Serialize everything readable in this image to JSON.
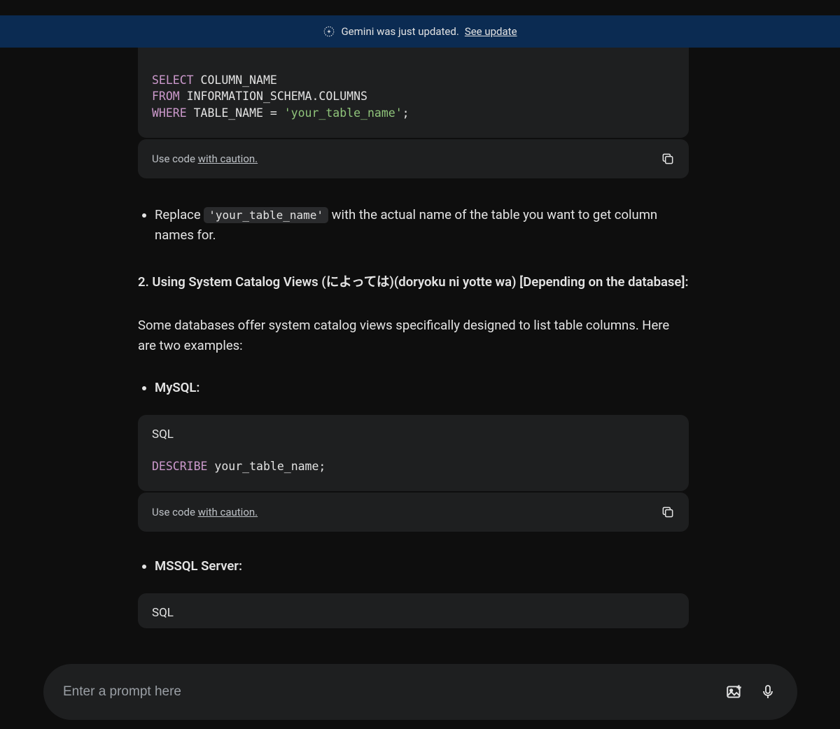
{
  "banner": {
    "text": "Gemini was just updated.",
    "link": "See update"
  },
  "code1": {
    "select": "SELECT",
    "col_name": " COLUMN_NAME",
    "from": "FROM",
    "info_schema": " INFORMATION_SCHEMA.COLUMNS",
    "where": "WHERE",
    "table_eq": " TABLE_NAME = ",
    "str": "'your_table_name'",
    "semi": ";"
  },
  "caution": {
    "prefix": "Use code ",
    "link": "with caution."
  },
  "replace_line": {
    "pre": "Replace ",
    "code": "'your_table_name'",
    "post": " with the actual name of the table you want to get column names for."
  },
  "heading2": "2. Using System Catalog Views (によっては)(doryoku ni yotte wa) [Depending on the database]:",
  "para2": "Some databases offer system catalog views specifically designed to list table columns. Here are two examples:",
  "mysql_label": "MySQL:",
  "sql_label": "SQL",
  "code2": {
    "describe": "DESCRIBE",
    "tbl": " your_table_name;"
  },
  "mssql_label": "MSSQL Server:",
  "input": {
    "placeholder": "Enter a prompt here"
  }
}
